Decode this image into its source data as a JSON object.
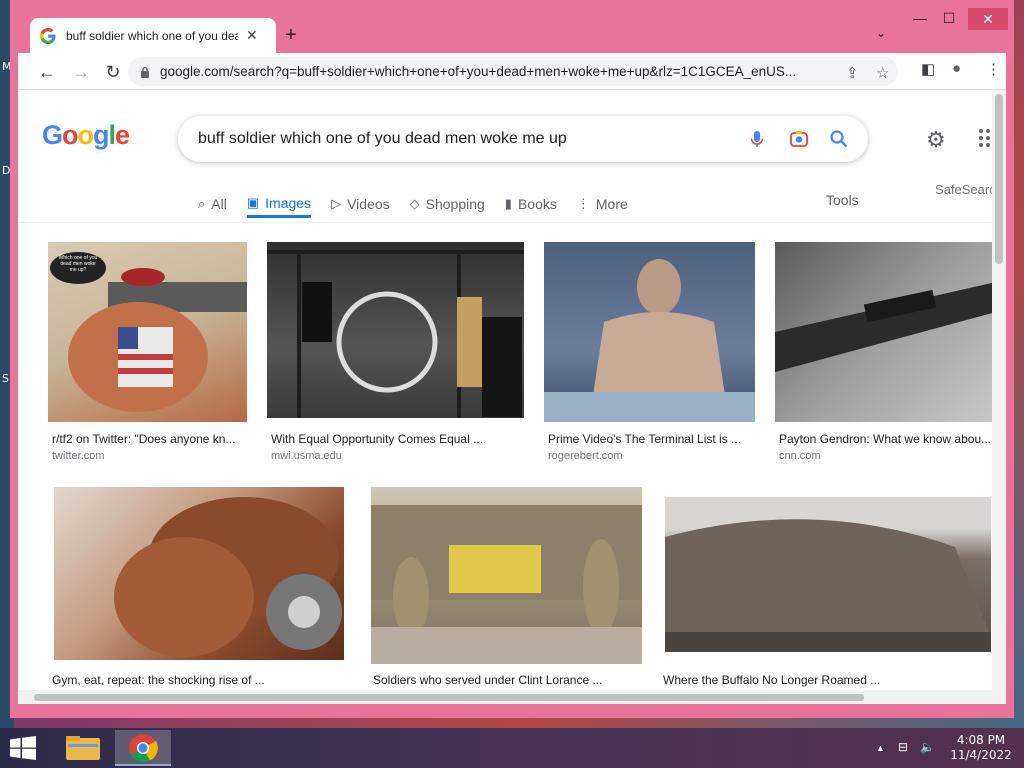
{
  "desktop": {
    "icon_letters": [
      "M",
      "D",
      "Sl"
    ]
  },
  "browser": {
    "tab_title": "buff soldier which one of you dead men woke me up - Google Search",
    "tab_close": "✕",
    "new_tab": "+",
    "tab_dropdown": "⌄",
    "window_controls": {
      "minimize": "—",
      "maximize": "☐",
      "close": "✕"
    },
    "nav": {
      "back": "←",
      "forward": "→",
      "reload": "↻"
    },
    "url": "google.com/search?q=buff+soldier+which+one+of+you+dead+men+woke+me+up&rlz=1C1GCEA_enUS...",
    "icons": {
      "share": "⇪",
      "bookmark": "☆",
      "sidepanel": "◧",
      "profile": "●",
      "menu": "⋮"
    }
  },
  "google": {
    "logo_letters": [
      "G",
      "o",
      "o",
      "g",
      "l",
      "e"
    ],
    "logo_colors": [
      "#4285f4",
      "#ea4335",
      "#fbbc05",
      "#4285f4",
      "#34a853",
      "#ea4335"
    ],
    "query": "buff soldier which one of you dead men woke me up",
    "tabs": [
      {
        "label": "All",
        "icon": "⌕"
      },
      {
        "label": "Images",
        "icon": "▣",
        "active": true
      },
      {
        "label": "Videos",
        "icon": "▷"
      },
      {
        "label": "Shopping",
        "icon": "◇"
      },
      {
        "label": "Books",
        "icon": "▮"
      },
      {
        "label": "More",
        "icon": "⋮"
      }
    ],
    "tools_label": "Tools",
    "safesearch_label": "SafeSearch",
    "settings_icon": "⚙"
  },
  "results": [
    {
      "caption": "r/tf2 on Twitter: \"Does anyone kn...",
      "domain": "twitter.com",
      "bubble": "Which one of you dead men woke me up?",
      "colors": [
        "#d9cbb4",
        "#b66a44"
      ]
    },
    {
      "caption": "With Equal Opportunity Comes Equal ...",
      "domain": "mwi.usma.edu",
      "colors": [
        "#3a3a3a",
        "#6b6b6b"
      ]
    },
    {
      "caption": "Prime Video's The Terminal List is ...",
      "domain": "rogerebert.com",
      "colors": [
        "#5a6e8a",
        "#b9a28e"
      ]
    },
    {
      "caption": "Payton Gendron: What we know abou...",
      "domain": "cnn.com",
      "colors": [
        "#6f6f6f",
        "#bdbdbd"
      ]
    },
    {
      "caption": "Gym, eat, repeat: the shocking rise of ...",
      "domain": "",
      "colors": [
        "#6b3a25",
        "#b56a42"
      ]
    },
    {
      "caption": "Soldiers who served under Clint Lorance ...",
      "domain": "",
      "colors": [
        "#9a8c72",
        "#e0c84a"
      ]
    },
    {
      "caption": "Where the Buffalo No Longer Roamed ...",
      "domain": "",
      "colors": [
        "#5a5048",
        "#a39b92"
      ]
    }
  ],
  "taskbar": {
    "clock_time": "4:08 PM",
    "clock_date": "11/4/2022",
    "tray": {
      "chevron": "▲",
      "network": "⊟",
      "volume": "🔈"
    }
  }
}
